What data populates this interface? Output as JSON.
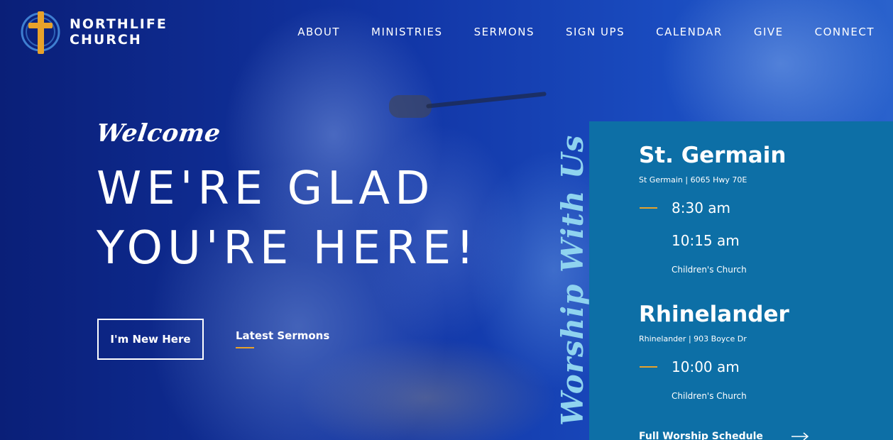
{
  "brand": {
    "line1": "NORTHLIFE",
    "line2": "CHURCH",
    "logo_icon": "cross-in-circle-icon",
    "accent_color": "#e8a22a"
  },
  "nav": {
    "items": [
      {
        "label": "ABOUT"
      },
      {
        "label": "MINISTRIES"
      },
      {
        "label": "SERMONS"
      },
      {
        "label": "SIGN UPS"
      },
      {
        "label": "CALENDAR"
      },
      {
        "label": "GIVE"
      },
      {
        "label": "CONNECT"
      }
    ]
  },
  "hero": {
    "welcome": "Welcome",
    "headline_line1": "WE'RE GLAD",
    "headline_line2": "YOU'RE HERE!",
    "primary_button": "I'm New Here",
    "secondary_link": "Latest Sermons"
  },
  "worship": {
    "vertical_title": "Worship With Us",
    "panel_color": "#0d6fa6",
    "locations": [
      {
        "name": "St. Germain",
        "address": "St Germain | 6065 Hwy 70E",
        "times": [
          "8:30 am",
          "10:15 am"
        ],
        "note": "Children's Church"
      },
      {
        "name": "Rhinelander",
        "address": "Rhinelander | 903 Boyce Dr",
        "times": [
          "10:00 am"
        ],
        "note": "Children's Church"
      }
    ],
    "schedule_link": "Full Worship Schedule",
    "schedule_icon": "arrow-right-icon"
  }
}
